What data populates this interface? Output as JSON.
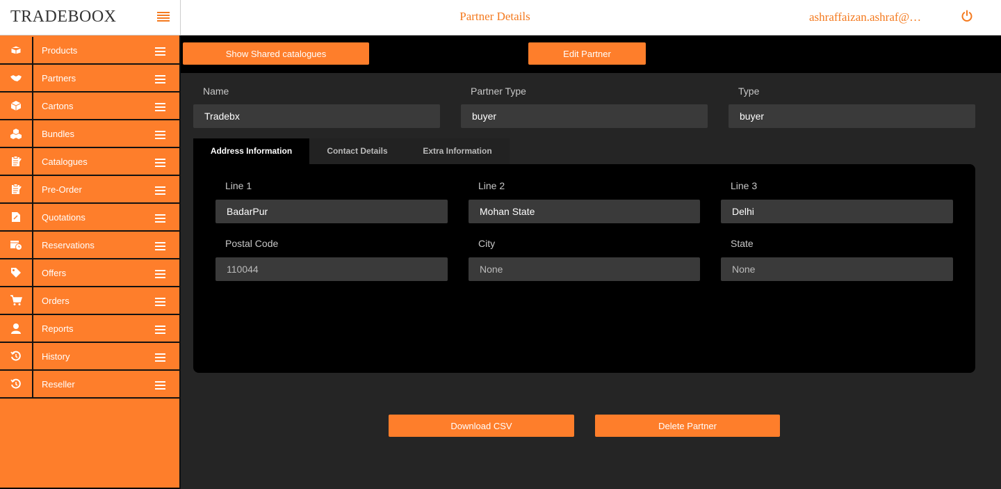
{
  "header": {
    "brand": "TRADEBOOX",
    "title": "Partner Details",
    "user_email": "ashraffaizan.ashraf@…"
  },
  "icons": {
    "menu": "hamburger-icon",
    "power": "power-icon"
  },
  "colors": {
    "accent": "#fe7e2b",
    "header_text": "#f47a1f",
    "background": "#252525",
    "panel": "#000000",
    "input": "#3a3a3a"
  },
  "sidebar": {
    "items": [
      {
        "label": "Products",
        "icon": "box-icon"
      },
      {
        "label": "Partners",
        "icon": "handshake-icon"
      },
      {
        "label": "Cartons",
        "icon": "cube-icon"
      },
      {
        "label": "Bundles",
        "icon": "cubes-icon"
      },
      {
        "label": "Catalogues",
        "icon": "clipboard-icon"
      },
      {
        "label": "Pre-Order",
        "icon": "clipboard-edit-icon"
      },
      {
        "label": "Quotations",
        "icon": "document-icon"
      },
      {
        "label": "Reservations",
        "icon": "calendar-clock-icon"
      },
      {
        "label": "Offers",
        "icon": "tag-icon"
      },
      {
        "label": "Orders",
        "icon": "cart-icon"
      },
      {
        "label": "Reports",
        "icon": "user-icon"
      },
      {
        "label": "History",
        "icon": "history-icon"
      },
      {
        "label": "Reseller",
        "icon": "history-icon"
      }
    ]
  },
  "toolbar": {
    "show_shared": "Show Shared catalogues",
    "edit_partner": "Edit Partner"
  },
  "partner": {
    "name_label": "Name",
    "name_value": "Tradebx",
    "partner_type_label": "Partner Type",
    "partner_type_value": "buyer",
    "type_label": "Type",
    "type_value": "buyer"
  },
  "tabs": [
    {
      "label": "Address Information",
      "active": true
    },
    {
      "label": "Contact Details",
      "active": false
    },
    {
      "label": "Extra Information",
      "active": false
    }
  ],
  "address": {
    "line1_label": "Line 1",
    "line1_value": "BadarPur",
    "line2_label": "Line 2",
    "line2_value": "Mohan State",
    "line3_label": "Line 3",
    "line3_value": "Delhi",
    "postal_label": "Postal Code",
    "postal_value": "110044",
    "city_label": "City",
    "city_value": "None",
    "state_label": "State",
    "state_value": "None"
  },
  "actions": {
    "download_csv": "Download CSV",
    "delete_partner": "Delete Partner"
  }
}
